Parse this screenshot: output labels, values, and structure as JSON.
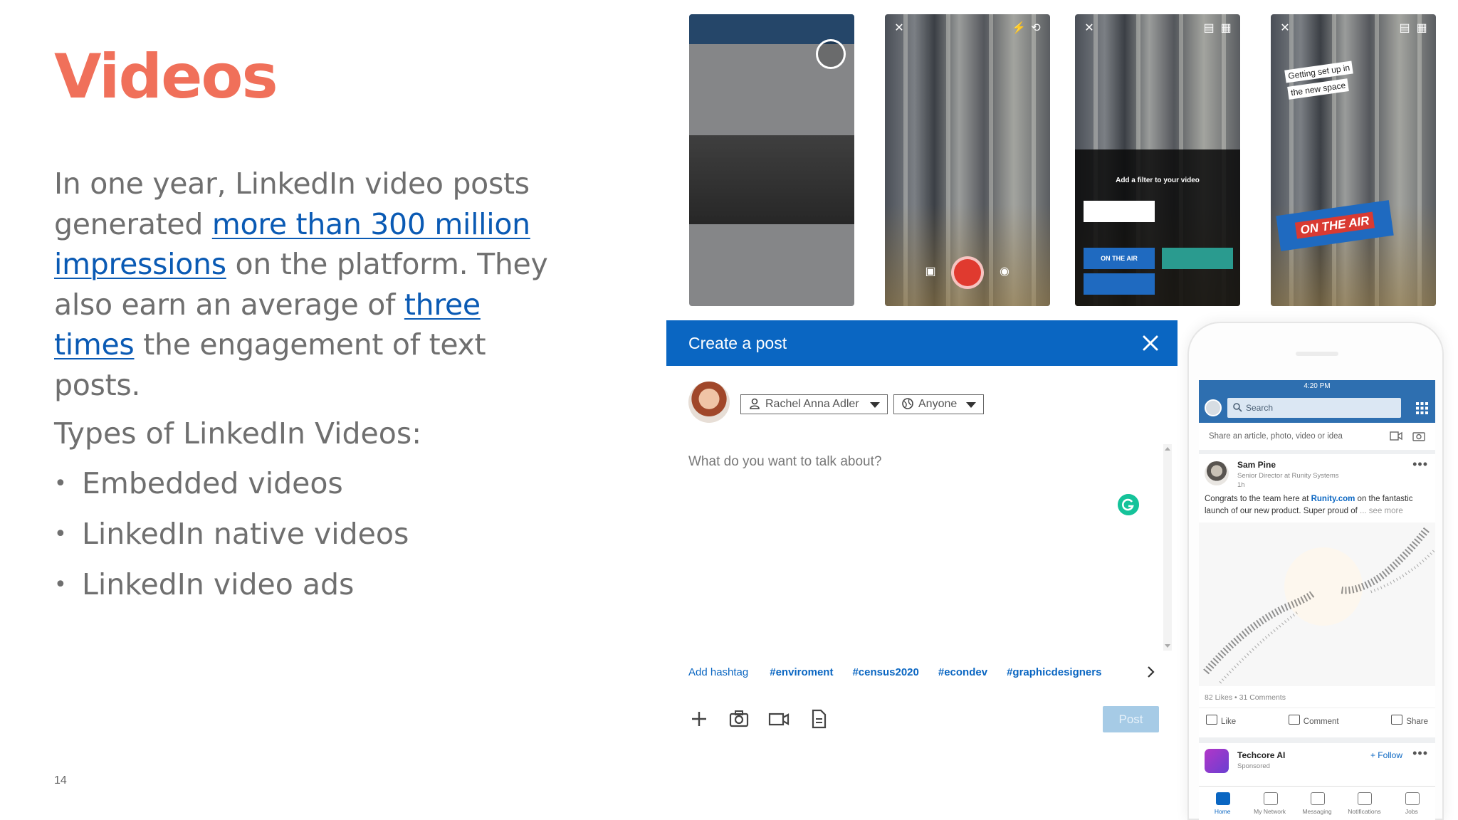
{
  "slide": {
    "title": "Videos",
    "paragraph": {
      "part1": "In one year, LinkedIn video posts generated ",
      "link1": "more than 300 million impressions",
      "part2": " on the platform. They also earn an average of ",
      "link2": "three times",
      "part3": " the engagement of text posts."
    },
    "types_heading": "Types of LinkedIn Videos:",
    "bullets": [
      "Embedded videos",
      "LinkedIn native videos",
      "LinkedIn video ads"
    ],
    "page_number": "14"
  },
  "screenshots": {
    "filter_title": "Add a filter to your video",
    "filter_live_chip": "ON THE AIR",
    "sticker_line1": "Getting set up in",
    "sticker_line2": "the new space",
    "on_the_air": "ON THE AIR"
  },
  "create_post": {
    "title": "Create a post",
    "author_select": "Rachel Anna Adler",
    "audience_select": "Anyone",
    "placeholder": "What do you want to talk about?",
    "add_hashtag": "Add hashtag",
    "hashtags": [
      "#enviroment",
      "#census2020",
      "#econdev",
      "#graphicdesigners"
    ],
    "post_button": "Post"
  },
  "phone": {
    "time": "4:20 PM",
    "search_placeholder": "Search",
    "share_prompt": "Share an article, photo, video or idea",
    "post": {
      "author": "Sam Pine",
      "author_title": "Senior Director at Runity Systems",
      "age": "1h",
      "text_before": "Congrats to the team here at ",
      "text_link": "Runity.com",
      "text_after": " on the fantastic launch of our new product. Super proud of ",
      "see_more": "... see more",
      "stats": "82 Likes • 31 Comments",
      "like": "Like",
      "comment": "Comment",
      "share": "Share"
    },
    "sponsored": {
      "name": "Techcore AI",
      "label": "Sponsored",
      "follow": "+ Follow"
    },
    "tabs": [
      "Home",
      "My Network",
      "Messaging",
      "Notifications",
      "Jobs"
    ]
  },
  "colors": {
    "title": "#f0705a",
    "link": "#0a5ab4",
    "linkedin_blue": "#0a66c2"
  }
}
